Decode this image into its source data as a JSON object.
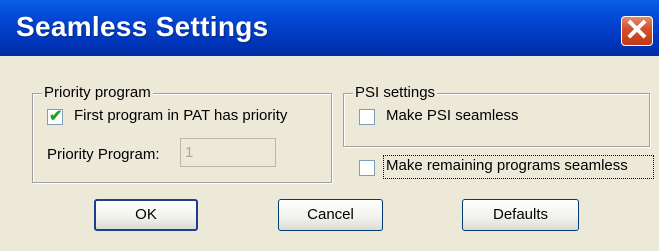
{
  "window": {
    "title": "Seamless Settings",
    "close_symbol": "✕"
  },
  "priority_group": {
    "legend": "Priority program",
    "checkbox_label": "First program in PAT has priority",
    "checkbox_checked": true,
    "field_label": "Priority Program:",
    "field_value": "1"
  },
  "psi_group": {
    "legend": "PSI settings",
    "checkbox_label": "Make PSI seamless",
    "checkbox_checked": false
  },
  "remaining": {
    "checkbox_label": "Make remaining programs seamless",
    "checkbox_checked": false
  },
  "buttons": {
    "ok": "OK",
    "cancel": "Cancel",
    "defaults": "Defaults"
  }
}
